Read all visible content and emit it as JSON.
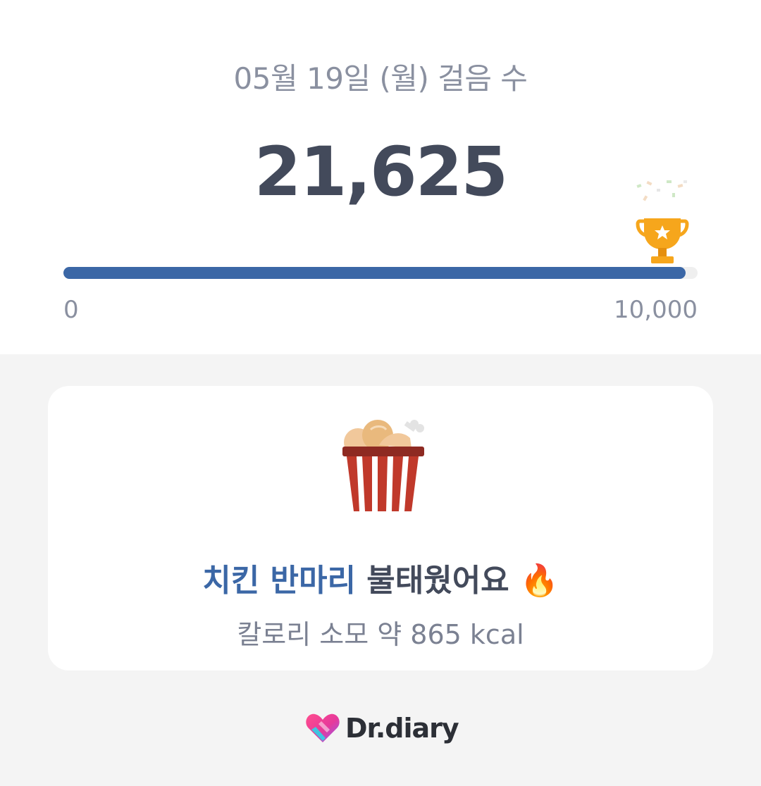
{
  "header": {
    "date_title": "05월 19일 (월) 걸음 수",
    "steps": "21,625"
  },
  "progress": {
    "value": 1.0,
    "min_label": "0",
    "max_label": "10,000",
    "accent_color": "#3b67a6",
    "icon": "trophy-icon"
  },
  "card": {
    "icon": "chicken-bucket-icon",
    "headline_accent": "치킨 반마리",
    "headline_rest": " 불태웠어요",
    "headline_emoji": "🔥",
    "calories": "칼로리 소모 약 865 kcal"
  },
  "brand": {
    "name": "Dr.diary",
    "icon": "heart-logo-icon"
  }
}
